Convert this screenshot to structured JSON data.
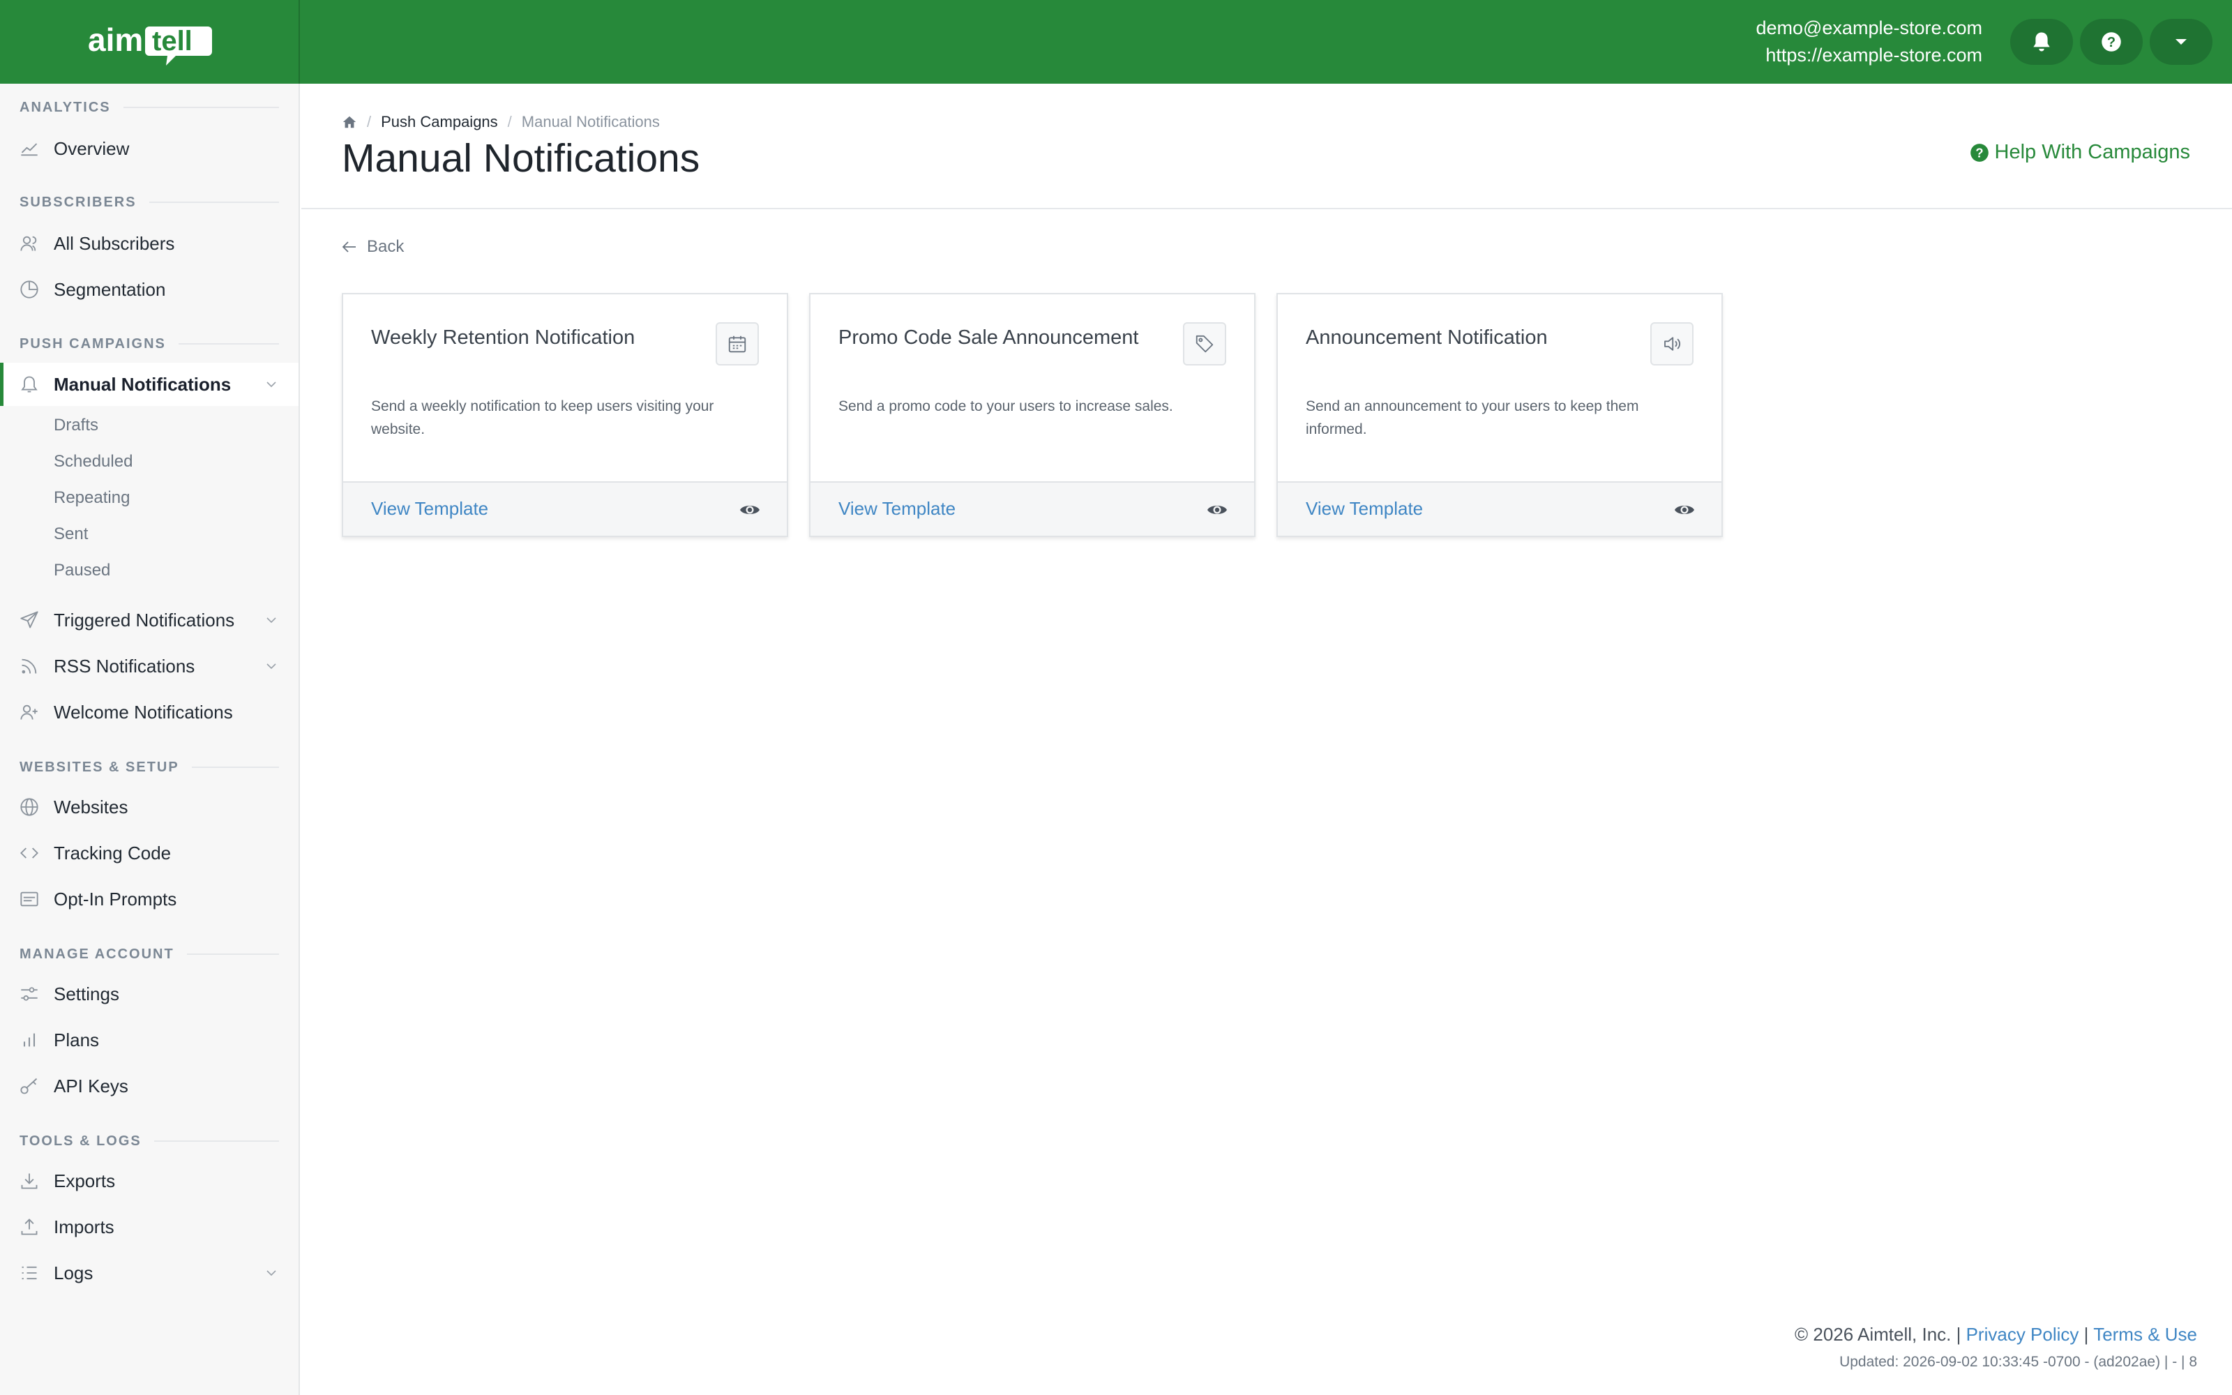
{
  "brand": {
    "logo_text": "aimtell",
    "logo_icon": "aimtell-logo"
  },
  "account": {
    "email": "demo@example-store.com",
    "site": "https://example-store.com",
    "bell_icon": "bell-icon",
    "help_icon": "question-circle-icon",
    "menu_icon": "caret-down-icon"
  },
  "sidebar": {
    "sections": [
      {
        "title": "ANALYTICS",
        "items": [
          {
            "label": "Overview",
            "icon": "chart-line-icon"
          }
        ]
      },
      {
        "title": "SUBSCRIBERS",
        "items": [
          {
            "label": "All Subscribers",
            "icon": "users-icon"
          },
          {
            "label": "Segmentation",
            "icon": "pie-chart-icon"
          }
        ]
      },
      {
        "title": "PUSH CAMPAIGNS",
        "items": [
          {
            "label": "Manual Notifications",
            "icon": "bell-icon",
            "active": true,
            "expanded": true,
            "subitems": [
              "Drafts",
              "Scheduled",
              "Repeating",
              "Sent",
              "Paused"
            ]
          },
          {
            "label": "Triggered Notifications",
            "icon": "paper-plane-icon"
          },
          {
            "label": "RSS Notifications",
            "icon": "rss-icon"
          },
          {
            "label": "Welcome Notifications",
            "icon": "user-plus-icon"
          }
        ]
      },
      {
        "title": "WEBSITES & SETUP",
        "items": [
          {
            "label": "Websites",
            "icon": "globe-icon"
          },
          {
            "label": "Tracking Code",
            "icon": "code-icon"
          },
          {
            "label": "Opt-In Prompts",
            "icon": "window-icon"
          }
        ]
      },
      {
        "title": "MANAGE ACCOUNT",
        "items": [
          {
            "label": "Settings",
            "icon": "sliders-icon"
          },
          {
            "label": "Plans",
            "icon": "bar-chart-icon"
          },
          {
            "label": "API Keys",
            "icon": "key-icon"
          }
        ]
      },
      {
        "title": "TOOLS & LOGS",
        "items": [
          {
            "label": "Exports",
            "icon": "download-icon"
          },
          {
            "label": "Imports",
            "icon": "upload-icon"
          },
          {
            "label": "Logs",
            "icon": "list-icon"
          }
        ]
      }
    ]
  },
  "breadcrumb": {
    "home_icon": "home-icon",
    "parent": "Push Campaigns",
    "current": "Manual Notifications"
  },
  "page": {
    "title": "Manual Notifications",
    "help_label": "Help With Campaigns",
    "back_label": "Back"
  },
  "cards": [
    {
      "title": "Weekly Retention Notification",
      "icon": "calendar-icon",
      "description": "Send a weekly notification to keep users visiting your website.",
      "action": "View Template",
      "action_icon": "eye-icon"
    },
    {
      "title": "Promo Code Sale Announcement",
      "icon": "tag-icon",
      "description": "Send a promo code to your users to increase sales.",
      "action": "View Template",
      "action_icon": "eye-icon"
    },
    {
      "title": "Announcement Notification",
      "icon": "megaphone-icon",
      "description": "Send an announcement to your users to keep them informed.",
      "action": "View Template",
      "action_icon": "eye-icon"
    }
  ],
  "footer": {
    "copyright": "© 2026 Aimtell, Inc. |",
    "privacy": "Privacy Policy",
    "divider": "|",
    "terms": "Terms & Use",
    "updated": "Updated: 2026-09-02 10:33:45 -0700 - (ad202ae) | - | 8"
  },
  "colors": {
    "brand_green": "#27893a",
    "link_blue": "#3f86c4",
    "sidebar_bg": "#f7f7f7"
  }
}
